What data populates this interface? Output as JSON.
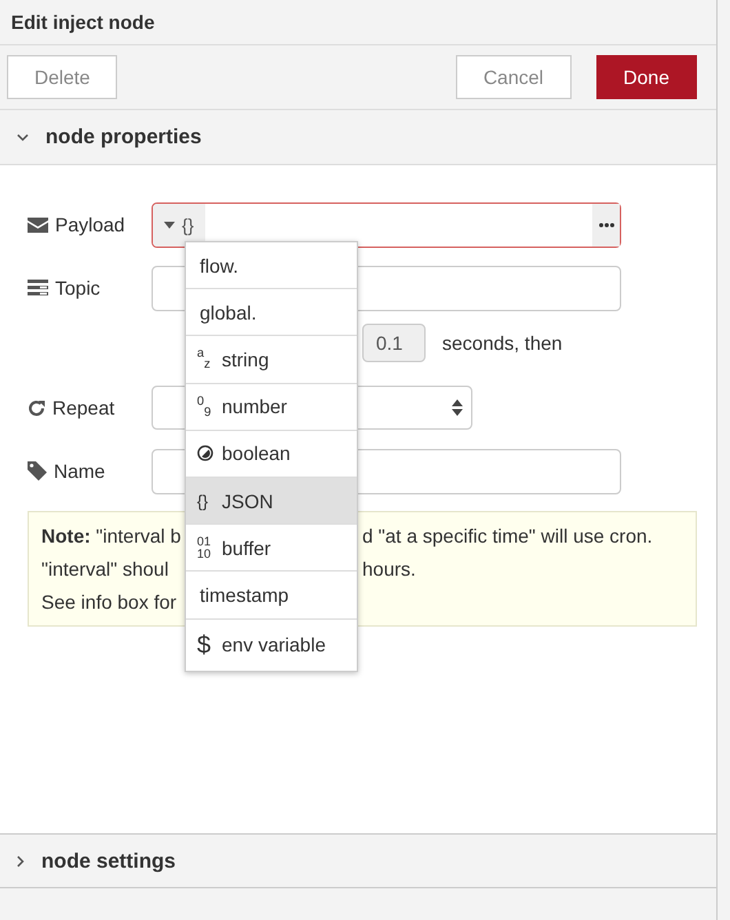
{
  "window": {
    "title": "Edit inject node"
  },
  "toolbar": {
    "buttons": [
      {
        "kind": "plain",
        "label": "Delete"
      },
      {
        "kind": "spacer"
      },
      {
        "kind": "plain",
        "label": "Cancel"
      },
      {
        "kind": "primary",
        "label": "Done"
      }
    ]
  },
  "sections": [
    {
      "title": "node properties",
      "expanded": true
    },
    {
      "title": "node settings",
      "expanded": false
    }
  ],
  "form": {
    "rows": [
      {
        "kind": "typed",
        "label": "Payload",
        "type_label": "{}",
        "invalid": true
      },
      {
        "kind": "text",
        "label": "Topic"
      },
      {
        "kind": "delay",
        "value": "0.1",
        "suffix": "seconds, then"
      },
      {
        "kind": "select",
        "label": "Repeat"
      },
      {
        "kind": "text",
        "label": "Name"
      }
    ]
  },
  "note": {
    "lines": [
      {
        "left": "**Note:** \"interval b",
        "right": "d \"at a specific time\" will use cron."
      },
      {
        "left": "\"interval\" shoul",
        "right": "hours."
      },
      {
        "left": "See info box for"
      }
    ]
  },
  "type_menu": {
    "items": [
      {
        "kind": "none",
        "label": "flow.",
        "selected": false
      },
      {
        "kind": "none",
        "label": "global.",
        "selected": false
      },
      {
        "kind": "rich",
        "icon": "$^{a}$$_{z}$",
        "label": "string",
        "selected": false
      },
      {
        "kind": "rich",
        "icon": "$^{0}$$_{9}$",
        "label": "number",
        "selected": false
      },
      {
        "kind": "toggle",
        "label": "boolean",
        "selected": false
      },
      {
        "kind": "text",
        "icon": "{}",
        "label": "JSON",
        "selected": true
      },
      {
        "kind": "stack",
        "icon_lines": [
          "01",
          "10"
        ],
        "label": "buffer",
        "selected": false
      },
      {
        "kind": "none",
        "label": "timestamp",
        "selected": false
      },
      {
        "kind": "big",
        "icon": "$",
        "label": "env variable",
        "selected": false
      }
    ]
  }
}
